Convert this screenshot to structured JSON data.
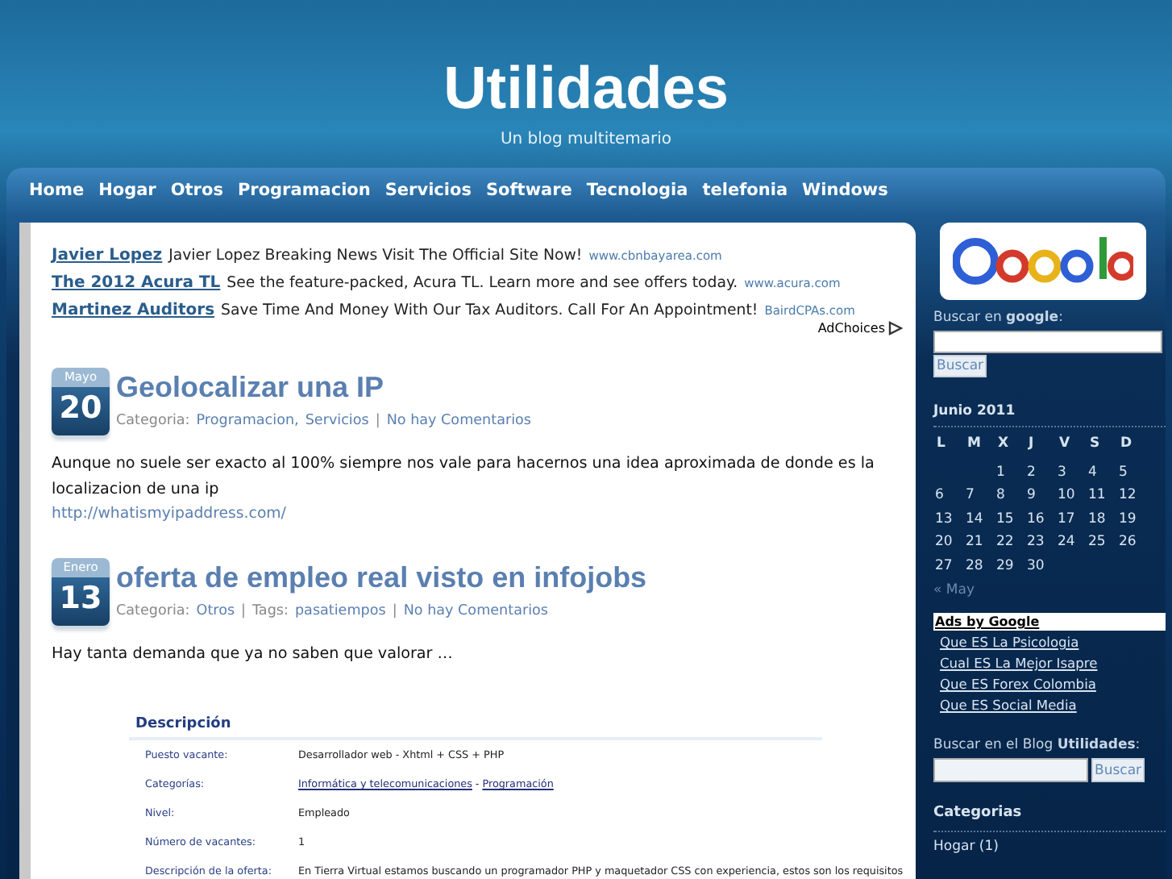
{
  "header": {
    "title": "Utilidades",
    "subtitle": "Un blog multitemario"
  },
  "nav": [
    "Home",
    "Hogar",
    "Otros",
    "Programacion",
    "Servicios",
    "Software",
    "Tecnologia",
    "telefonia",
    "Windows"
  ],
  "ads": [
    {
      "title": "Javier Lopez",
      "text": "Javier Lopez Breaking News Visit The Official Site Now!",
      "url": "www.cbnbayarea.com"
    },
    {
      "title": "The 2012 Acura TL",
      "text": "See the feature-packed, Acura TL. Learn more and see offers today.",
      "url": "www.acura.com"
    },
    {
      "title": "Martinez Auditors",
      "text": "Save Time And Money With Our Tax Auditors. Call For An Appointment!",
      "url": "BairdCPAs.com"
    }
  ],
  "adchoices": "AdChoices",
  "posts": [
    {
      "month": "Mayo",
      "day": "20",
      "title": "Geolocalizar una IP",
      "meta": [
        {
          "kind": "label",
          "text": "Categoria:"
        },
        {
          "kind": "link",
          "text": "Programacion,"
        },
        {
          "kind": "link",
          "text": "Servicios"
        },
        {
          "kind": "sep",
          "text": "|"
        },
        {
          "kind": "link",
          "text": "No hay Comentarios"
        }
      ],
      "body": "Aunque no suele ser exacto al 100% siempre nos vale para hacernos una idea aproximada de donde es la localizacion de una ip",
      "link": "http://whatismyipaddress.com/"
    },
    {
      "month": "Enero",
      "day": "13",
      "title": "oferta de empleo real visto en infojobs",
      "meta": [
        {
          "kind": "label",
          "text": "Categoria:"
        },
        {
          "kind": "link",
          "text": "Otros"
        },
        {
          "kind": "sep",
          "text": "|"
        },
        {
          "kind": "label",
          "text": "Tags:"
        },
        {
          "kind": "link",
          "text": "pasatiempos"
        },
        {
          "kind": "sep",
          "text": "|"
        },
        {
          "kind": "link",
          "text": "No hay Comentarios"
        }
      ],
      "body": "Hay tanta demanda que ya no saben que valorar …",
      "screenshot": {
        "heading": "Descripción",
        "rows": [
          {
            "label": "Puesto vacante:",
            "value": [
              {
                "kind": "text",
                "text": "Desarrollador web - Xhtml + CSS + PHP"
              }
            ]
          },
          {
            "label": "Categorías:",
            "value": [
              {
                "kind": "link",
                "text": "Informática y telecomunicaciones"
              },
              {
                "kind": "text",
                "text": "-"
              },
              {
                "kind": "link",
                "text": "Programación"
              }
            ]
          },
          {
            "label": "Nivel:",
            "value": [
              {
                "kind": "text",
                "text": "Empleado"
              }
            ]
          },
          {
            "label": "Número de vacantes:",
            "value": [
              {
                "kind": "text",
                "text": "1"
              }
            ]
          },
          {
            "label": "Descripción de la oferta:",
            "value": [
              {
                "kind": "text",
                "text": "En Tierra Virtual estamos buscando un programador PHP y maquetador CSS con experiencia, estos son los requisitos"
              }
            ]
          }
        ]
      }
    }
  ],
  "sidebar": {
    "google_search": {
      "label": "Buscar en **google**:",
      "button": "Buscar"
    },
    "calendar": {
      "caption": "Junio 2011",
      "weekdays": [
        "L",
        "M",
        "X",
        "J",
        "V",
        "S",
        "D"
      ],
      "weeks": [
        [
          "1",
          "2",
          "3",
          "4",
          "5"
        ],
        [
          "6",
          "7",
          "8",
          "9",
          "10",
          "11",
          "12"
        ],
        [
          "13",
          "14",
          "15",
          "16",
          "17",
          "18",
          "19"
        ],
        [
          "20",
          "21",
          "22",
          "23",
          "24",
          "25",
          "26"
        ],
        [
          "27",
          "28",
          "29",
          "30"
        ]
      ],
      "prev": "« May"
    },
    "ads_by_google": {
      "title": "Ads by Google",
      "links": [
        "Que ES La Psicologia",
        "Cual ES La Mejor Isapre",
        "Que ES Forex Colombia",
        "Que ES Social Media"
      ]
    },
    "blog_search": {
      "label": "Buscar en el Blog **Utilidades**:",
      "button": "Buscar"
    },
    "categories": {
      "title": "Categorias",
      "items": [
        "Hogar (1)"
      ]
    }
  }
}
